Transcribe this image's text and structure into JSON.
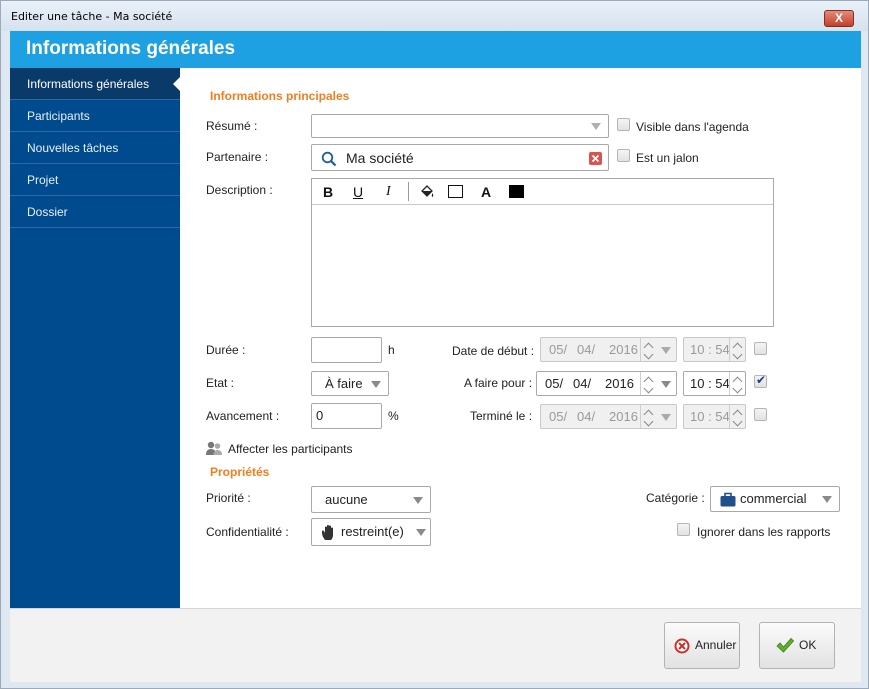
{
  "window": {
    "title": "Editer une tâche - Ma société",
    "close": "X"
  },
  "header": {
    "title": "Informations générales"
  },
  "sidebar": {
    "items": [
      {
        "label": "Informations générales"
      },
      {
        "label": "Participants"
      },
      {
        "label": "Nouvelles tâches"
      },
      {
        "label": "Projet"
      },
      {
        "label": "Dossier"
      }
    ]
  },
  "main": {
    "section_main": "Informations principales",
    "resume": {
      "label": "Résumé :",
      "value": ""
    },
    "visible_agenda": {
      "label": "Visible dans l'agenda",
      "checked": false
    },
    "partenaire": {
      "label": "Partenaire :",
      "value": "Ma société"
    },
    "jalon": {
      "label": "Est un jalon",
      "checked": false
    },
    "description": {
      "label": "Description :",
      "bold": "B",
      "underline": "U",
      "italic": "I",
      "font": "A"
    },
    "duree": {
      "label": "Durée :",
      "value": "",
      "unit": "h"
    },
    "etat": {
      "label": "Etat :",
      "value": "À faire"
    },
    "avancement": {
      "label": "Avancement :",
      "value": "0",
      "unit": "%"
    },
    "date_debut": {
      "label": "Date de début :",
      "day": "05/",
      "month": "04/",
      "year": "2016",
      "time": "10 : 54",
      "checked": false
    },
    "a_faire_pour": {
      "label": "A faire pour :",
      "day": "05/",
      "month": "04/",
      "year": "2016",
      "time": "10 : 54",
      "checked": true
    },
    "termine_le": {
      "label": "Terminé le :",
      "day": "05/",
      "month": "04/",
      "year": "2016",
      "time": "10 : 54",
      "checked": false
    },
    "affecter": {
      "label": "Affecter les participants"
    },
    "section_props": "Propriétés",
    "priorite": {
      "label": "Priorité :",
      "value": "aucune"
    },
    "confidentialite": {
      "label": "Confidentialité :",
      "value": "restreint(e)"
    },
    "categorie": {
      "label": "Catégorie :",
      "value": "commercial"
    },
    "ignorer": {
      "label": "Ignorer dans les rapports",
      "checked": false
    }
  },
  "footer": {
    "cancel": "Annuler",
    "ok": "OK"
  },
  "colors": {
    "header": "#1ea1e2",
    "sidebar": "#004b8d",
    "section": "#f07e1f"
  }
}
